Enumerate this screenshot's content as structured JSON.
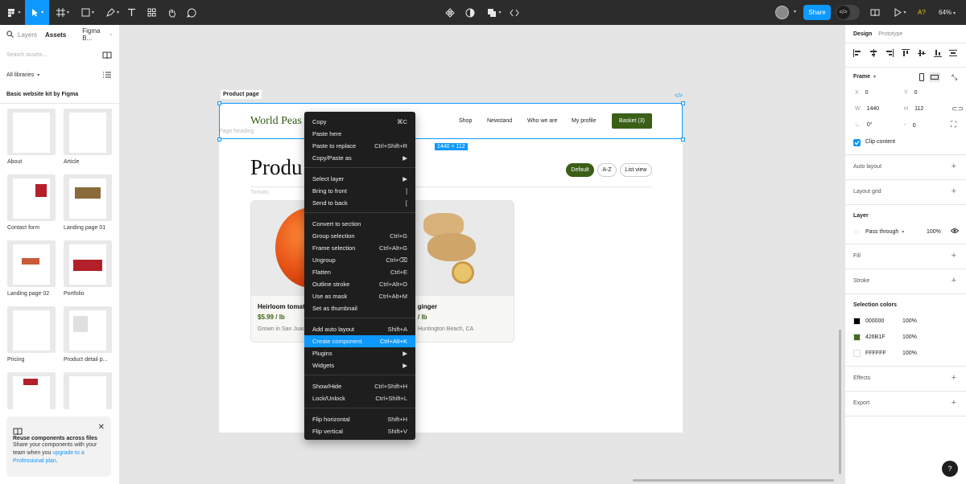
{
  "toolbar": {
    "share_label": "Share",
    "zoom": "64%",
    "ai_label": "A?",
    "icons": [
      "figma-menu-icon",
      "move-icon",
      "frame-icon",
      "shape-icon",
      "pen-icon",
      "text-icon",
      "resources-icon",
      "hand-icon",
      "comment-icon",
      "component-icon",
      "contrast-icon",
      "boolean-icon",
      "code-icon",
      "library-icon",
      "present-icon"
    ]
  },
  "left_panel": {
    "tabs": [
      "Layers",
      "Assets",
      "Figma B..."
    ],
    "search_placeholder": "Search assets...",
    "libraries_label": "All libraries",
    "kit_title": "Basic website kit by Figma",
    "thumbnails": [
      {
        "label": "About"
      },
      {
        "label": "Article"
      },
      {
        "label": "Contact form"
      },
      {
        "label": "Landing page 01"
      },
      {
        "label": "Landing page 02"
      },
      {
        "label": "Portfolio"
      },
      {
        "label": "Pricing"
      },
      {
        "label": "Product detail p..."
      },
      {
        "label": ""
      },
      {
        "label": ""
      }
    ],
    "callout": {
      "title": "Reuse components across files",
      "body_1": "Share your components with your",
      "body_2_a": "team when you ",
      "body_2_link": "upgrade to a",
      "body_3_link": "Professional plan",
      "body_3_end": "."
    }
  },
  "canvas": {
    "frame_label": "Product page",
    "dimension_badge": "1440 × 112",
    "code_tag": "</>",
    "logo": "World Peas",
    "nav": [
      "Shop",
      "Newstand",
      "Who we are",
      "My profile"
    ],
    "basket": "Basket (3)",
    "ghost_heading": "Page heading",
    "product_title": "Produ",
    "pills": [
      "Default",
      "A-Z",
      "List view"
    ],
    "tomato_label": "Tomato",
    "cards": [
      {
        "name": "Heirloom tomat",
        "price": "$5.99 / lb",
        "sub": "Grown in San Juan"
      },
      {
        "name": "c ginger",
        "price": "/ lb",
        "sub": "Huntington Beach, CA"
      }
    ]
  },
  "context_menu": {
    "groups": [
      [
        {
          "label": "Copy",
          "shortcut": "⌘C"
        },
        {
          "label": "Paste here",
          "shortcut": ""
        },
        {
          "label": "Paste to replace",
          "shortcut": "Ctrl+Shift+R"
        },
        {
          "label": "Copy/Paste as",
          "shortcut": "▶"
        }
      ],
      [
        {
          "label": "Select layer",
          "shortcut": "▶"
        },
        {
          "label": "Bring to front",
          "shortcut": "]"
        },
        {
          "label": "Send to back",
          "shortcut": "["
        }
      ],
      [
        {
          "label": "Convert to section",
          "shortcut": ""
        },
        {
          "label": "Group selection",
          "shortcut": "Ctrl+G"
        },
        {
          "label": "Frame selection",
          "shortcut": "Ctrl+Alt+G"
        },
        {
          "label": "Ungroup",
          "shortcut": "Ctrl+⌫"
        },
        {
          "label": "Flatten",
          "shortcut": "Ctrl+E"
        },
        {
          "label": "Outline stroke",
          "shortcut": "Ctrl+Alt+O"
        },
        {
          "label": "Use as mask",
          "shortcut": "Ctrl+Alt+M"
        },
        {
          "label": "Set as thumbnail",
          "shortcut": ""
        }
      ],
      [
        {
          "label": "Add auto layout",
          "shortcut": "Shift+A"
        },
        {
          "label": "Create component",
          "shortcut": "Ctrl+Alt+K",
          "highlighted": true
        },
        {
          "label": "Plugins",
          "shortcut": "▶"
        },
        {
          "label": "Widgets",
          "shortcut": "▶"
        }
      ],
      [
        {
          "label": "Show/Hide",
          "shortcut": "Ctrl+Shift+H"
        },
        {
          "label": "Lock/Unlock",
          "shortcut": "Ctrl+Shift+L"
        }
      ],
      [
        {
          "label": "Flip horizontal",
          "shortcut": "Shift+H"
        },
        {
          "label": "Flip vertical",
          "shortcut": "Shift+V"
        }
      ]
    ]
  },
  "right_panel": {
    "tabs": [
      "Design",
      "Prototype"
    ],
    "frame_heading": "Frame",
    "x": "0",
    "y": "0",
    "w": "1440",
    "h": "112",
    "rotation": "0°",
    "radius": "0",
    "clip_content": "Clip content",
    "sections": [
      "Auto layout",
      "Layout grid"
    ],
    "layer_heading": "Layer",
    "blend_mode": "Pass through",
    "layer_opacity": "100%",
    "fill_heading": "Fill",
    "stroke_heading": "Stroke",
    "selection_colors_heading": "Selection colors",
    "colors": [
      {
        "hex": "000000",
        "opacity": "100%",
        "swatch": "#000000"
      },
      {
        "hex": "426B1F",
        "opacity": "100%",
        "swatch": "#426B1F"
      },
      {
        "hex": "FFFFFF",
        "opacity": "100%",
        "swatch": "#FFFFFF"
      }
    ],
    "effects_heading": "Effects",
    "export_heading": "Export",
    "help_label": "?"
  }
}
